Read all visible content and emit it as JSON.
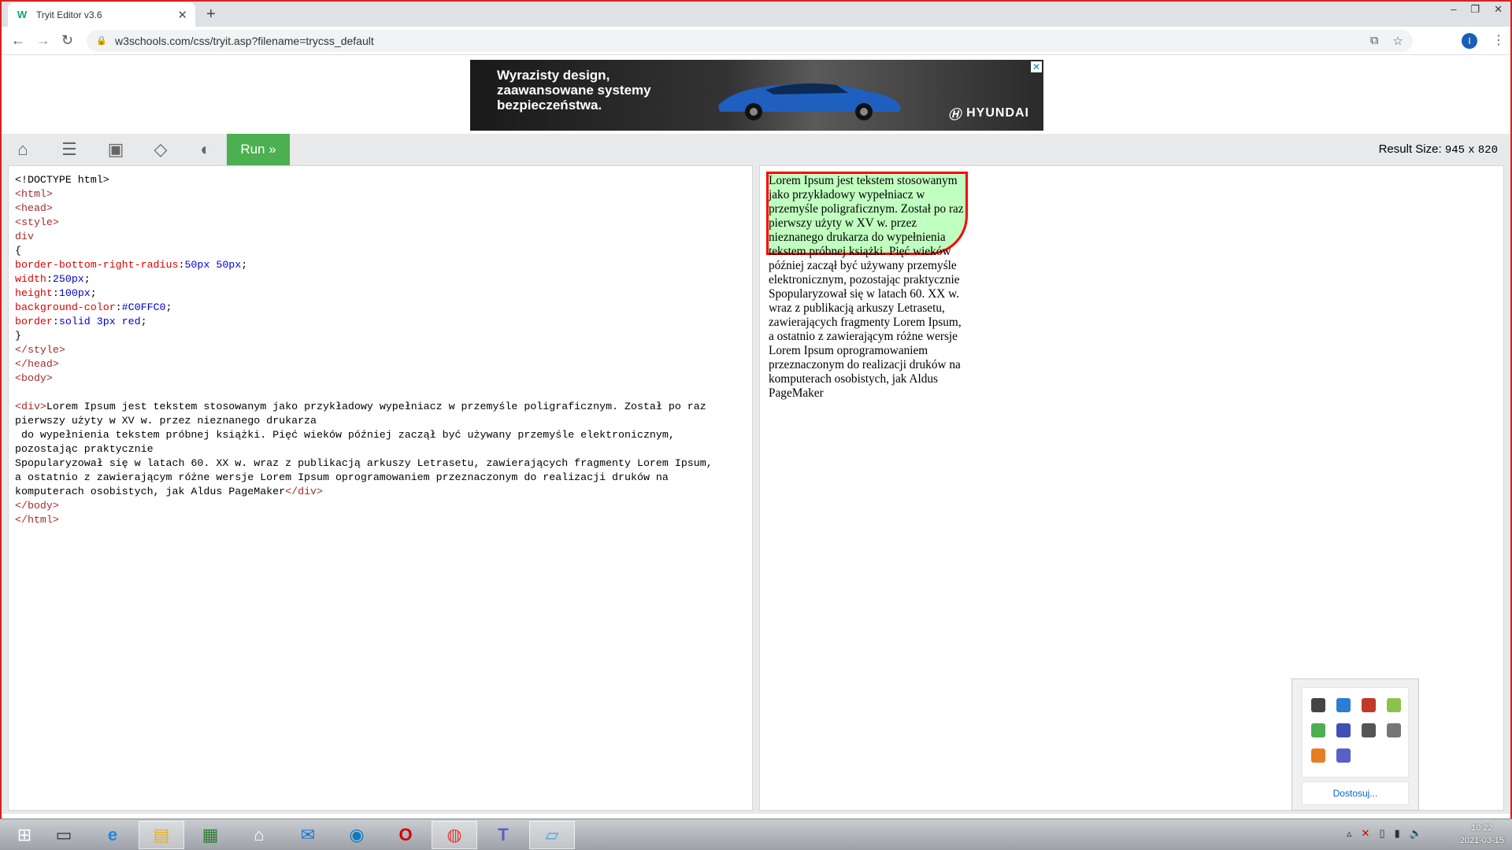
{
  "browser": {
    "tab_title": "Tryit Editor v3.6",
    "tab_favicon": "W",
    "tab_close": "✕",
    "new_tab": "+",
    "url": "w3schools.com/css/tryit.asp?filename=trycss_default",
    "profile_initial": "I",
    "window_controls": [
      "–",
      "❐",
      "✕"
    ]
  },
  "ad": {
    "headline": "Wyrazisty design, zaawansowane systemy bezpieczeństwa.",
    "brand": "HYUNDAI",
    "close": "✕"
  },
  "editor": {
    "run_label": "Run »",
    "result_size_label": "Result Size:",
    "result_width": "945",
    "result_x": "x",
    "result_height": "820",
    "code_lines": [
      [
        {
          "t": "<!DOCTYPE html>",
          "c": ""
        }
      ],
      [
        {
          "t": "<html>",
          "c": "tag"
        }
      ],
      [
        {
          "t": "<head>",
          "c": "tag"
        }
      ],
      [
        {
          "t": "<style>",
          "c": "tag"
        }
      ],
      [
        {
          "t": "div",
          "c": "tag"
        }
      ],
      [
        {
          "t": "{",
          "c": ""
        }
      ],
      [
        {
          "t": "border-bottom-right-radius",
          "c": "prop"
        },
        {
          "t": ":",
          "c": ""
        },
        {
          "t": "50px 50px",
          "c": "val"
        },
        {
          "t": ";",
          "c": ""
        }
      ],
      [
        {
          "t": "width",
          "c": "prop"
        },
        {
          "t": ":",
          "c": ""
        },
        {
          "t": "250px",
          "c": "val"
        },
        {
          "t": ";",
          "c": ""
        }
      ],
      [
        {
          "t": "height",
          "c": "prop"
        },
        {
          "t": ":",
          "c": ""
        },
        {
          "t": "100px",
          "c": "val"
        },
        {
          "t": ";",
          "c": ""
        }
      ],
      [
        {
          "t": "background-color",
          "c": "prop"
        },
        {
          "t": ":",
          "c": ""
        },
        {
          "t": "#C0FFC0",
          "c": "val"
        },
        {
          "t": ";",
          "c": ""
        }
      ],
      [
        {
          "t": "border",
          "c": "prop"
        },
        {
          "t": ":",
          "c": ""
        },
        {
          "t": "solid 3px red",
          "c": "val"
        },
        {
          "t": ";",
          "c": ""
        }
      ],
      [
        {
          "t": "}",
          "c": ""
        }
      ],
      [
        {
          "t": "</style>",
          "c": "tag"
        }
      ],
      [
        {
          "t": "</head>",
          "c": "tag"
        }
      ],
      [
        {
          "t": "<body>",
          "c": "tag"
        }
      ],
      [
        {
          "t": "",
          "c": ""
        }
      ],
      [
        {
          "t": "<div>",
          "c": "tag"
        },
        {
          "t": "Lorem Ipsum jest tekstem stosowanym jako przykładowy wypełniacz w przemyśle poligraficznym. Został po raz",
          "c": ""
        }
      ],
      [
        {
          "t": "pierwszy użyty w XV w. przez nieznanego drukarza",
          "c": ""
        }
      ],
      [
        {
          "t": " do wypełnienia tekstem próbnej książki. Pięć wieków później zaczął być używany przemyśle elektronicznym,",
          "c": ""
        }
      ],
      [
        {
          "t": "pozostając praktycznie",
          "c": ""
        }
      ],
      [
        {
          "t": "Spopularyzował się w latach 60. XX w. wraz z publikacją arkuszy Letrasetu, zawierających fragmenty Lorem Ipsum,",
          "c": ""
        }
      ],
      [
        {
          "t": "a ostatnio z zawierającym różne wersje Lorem Ipsum oprogramowaniem przeznaczonym do realizacji druków na",
          "c": ""
        }
      ],
      [
        {
          "t": "komputerach osobistych, jak Aldus PageMaker",
          "c": ""
        },
        {
          "t": "</div>",
          "c": "tag"
        }
      ],
      [
        {
          "t": "</body>",
          "c": "tag"
        }
      ],
      [
        {
          "t": "</html>",
          "c": "tag"
        }
      ]
    ]
  },
  "result": {
    "text": "Lorem Ipsum jest tekstem stosowanym jako przykładowy wypełniacz w przemyśle poligraficznym. Został po raz pierwszy użyty w XV w. przez nieznanego drukarza do wypełnienia tekstem próbnej książki. Pięć wieków później zaczął być używany przemyśle elektronicznym, pozostając praktycznie Spopularyzował się w latach 60. XX w. wraz z publikacją arkuszy Letrasetu, zawierających fragmenty Lorem Ipsum, a ostatnio z zawierającym różne wersje Lorem Ipsum oprogramowaniem przeznaczonym do realizacji druków na komputerach osobistych, jak Aldus PageMaker",
    "box_background": "#C0FFC0",
    "box_border": "red"
  },
  "tray": {
    "customize_label": "Dostosuj...",
    "icons": [
      "monitor-icon",
      "network-app-icon",
      "bluetooth-icon",
      "green-update-icon",
      "security-check-icon",
      "package-icon",
      "camera-icon",
      "printer-icon",
      "office-icon",
      "teams-icon"
    ]
  },
  "taskbar": {
    "time": "10:22",
    "date": "2021-03-15"
  }
}
